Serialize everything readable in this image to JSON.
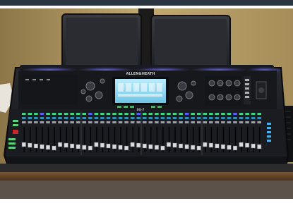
{
  "scene": {
    "subject": "digital mixing console",
    "elements": [
      "two tablets on stands",
      "central touchscreen",
      "rotary encoders",
      "motorized fader banks",
      "blue accent LED strip",
      "wooden shelf",
      "beige wall"
    ]
  },
  "console": {
    "brand_text": "ALLEN&HEATH",
    "model_text": "SQ-7"
  },
  "colors": {
    "wall": "#b8a06a",
    "console_body": "#1c1d22",
    "accent_led": "#5a5cff",
    "screen": "#8fd8f0",
    "shelf": "#6b4a2e"
  }
}
